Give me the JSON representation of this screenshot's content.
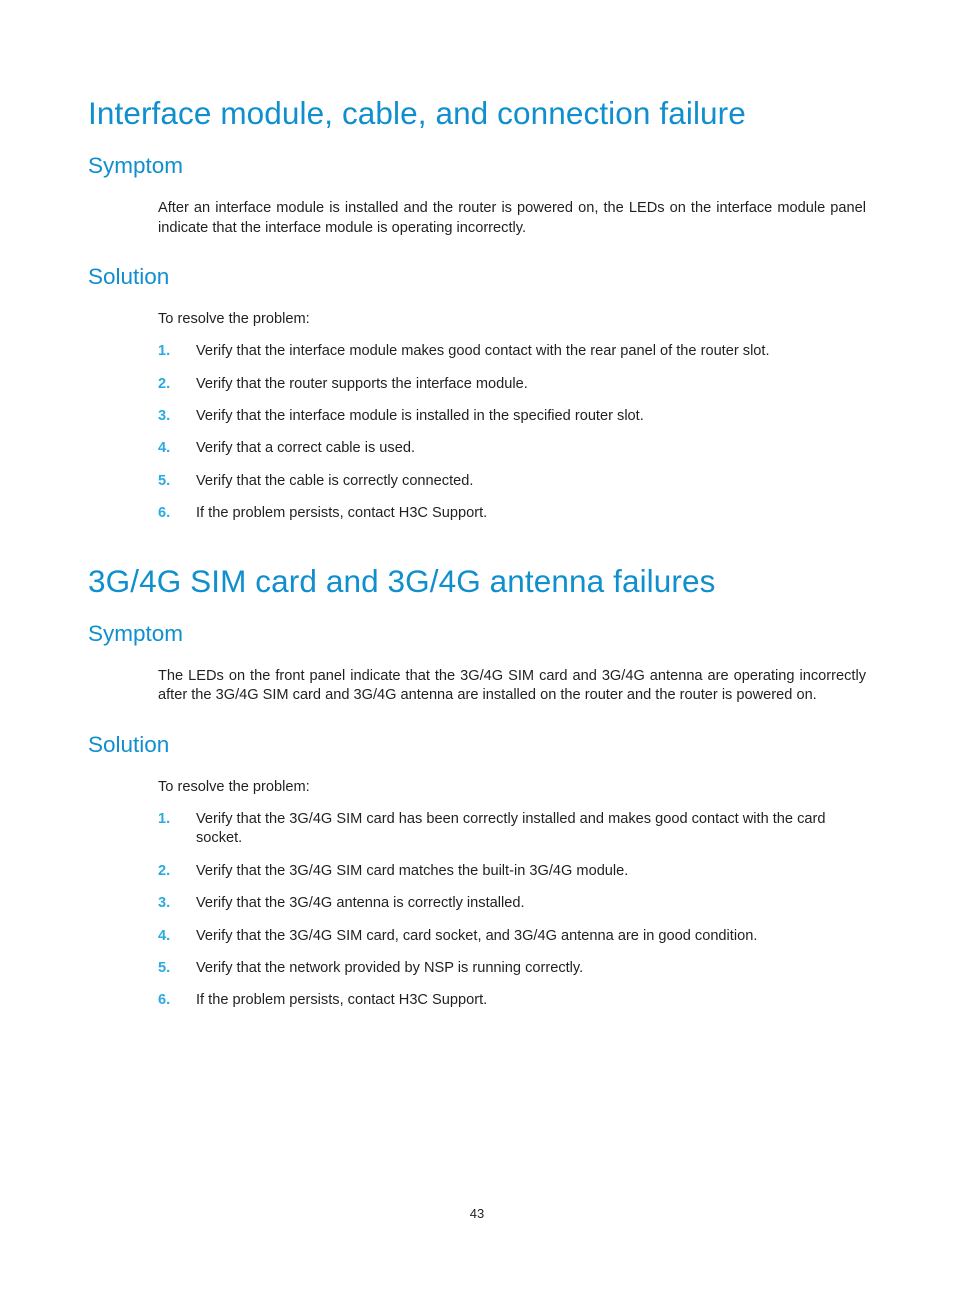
{
  "page": {
    "number": "43"
  },
  "sections": [
    {
      "title": "Interface module, cable, and connection failure",
      "symptom_heading": "Symptom",
      "symptom_text": "After an interface module is installed and the router is powered on, the LEDs on the interface module panel indicate that the interface module is operating incorrectly.",
      "solution_heading": "Solution",
      "solution_lead": "To resolve the problem:",
      "steps": [
        {
          "num": "1.",
          "text": "Verify that the interface module makes good contact with the rear panel of the router slot."
        },
        {
          "num": "2.",
          "text": "Verify that the router supports the interface module."
        },
        {
          "num": "3.",
          "text": "Verify that the interface module is installed in the specified router slot."
        },
        {
          "num": "4.",
          "text": "Verify that a correct cable is used."
        },
        {
          "num": "5.",
          "text": "Verify that the cable is correctly connected."
        },
        {
          "num": "6.",
          "text": "If the problem persists, contact H3C Support."
        }
      ]
    },
    {
      "title": "3G/4G SIM card and 3G/4G antenna failures",
      "symptom_heading": "Symptom",
      "symptom_text": "The LEDs on the front panel indicate that the 3G/4G SIM card and 3G/4G antenna are operating incorrectly after the 3G/4G SIM card and 3G/4G antenna are installed on the router and the router is powered on.",
      "solution_heading": "Solution",
      "solution_lead": "To resolve the problem:",
      "steps": [
        {
          "num": "1.",
          "text": "Verify that the 3G/4G SIM card has been correctly installed and makes good contact with the card socket."
        },
        {
          "num": "2.",
          "text": "Verify that the 3G/4G SIM card matches the built-in 3G/4G module."
        },
        {
          "num": "3.",
          "text": "Verify that the 3G/4G antenna is correctly installed."
        },
        {
          "num": "4.",
          "text": "Verify that the 3G/4G SIM card, card socket, and 3G/4G antenna are in good condition."
        },
        {
          "num": "5.",
          "text": "Verify that the network provided by NSP is running correctly."
        },
        {
          "num": "6.",
          "text": "If the problem persists, contact H3C Support."
        }
      ]
    }
  ],
  "colors": {
    "heading_blue": "#0f8fce",
    "number_blue": "#29abe2",
    "body_text": "#231f20"
  }
}
